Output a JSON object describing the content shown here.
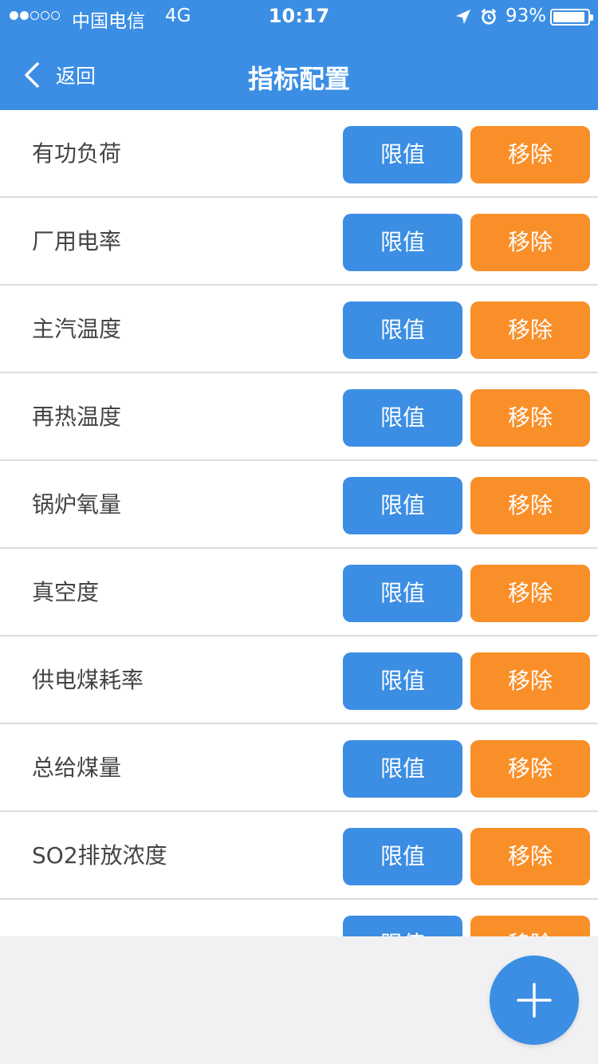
{
  "status_bar": {
    "carrier": "中国电信",
    "network": "4G",
    "time": "10:17",
    "battery_percent": "93%",
    "battery_level": 0.93,
    "signal_bars_filled": 2,
    "signal_bars_total": 5,
    "icons": [
      "location-icon",
      "alarm-icon",
      "battery-icon"
    ]
  },
  "nav": {
    "back_label": "返回",
    "title": "指标配置"
  },
  "items": [
    {
      "label": "有功负荷",
      "limit_label": "限值",
      "remove_label": "移除"
    },
    {
      "label": "厂用电率",
      "limit_label": "限值",
      "remove_label": "移除"
    },
    {
      "label": "主汽温度",
      "limit_label": "限值",
      "remove_label": "移除"
    },
    {
      "label": "再热温度",
      "limit_label": "限值",
      "remove_label": "移除"
    },
    {
      "label": "锅炉氧量",
      "limit_label": "限值",
      "remove_label": "移除"
    },
    {
      "label": "真空度",
      "limit_label": "限值",
      "remove_label": "移除"
    },
    {
      "label": "供电煤耗率",
      "limit_label": "限值",
      "remove_label": "移除"
    },
    {
      "label": "总给煤量",
      "limit_label": "限值",
      "remove_label": "移除"
    },
    {
      "label": "SO2排放浓度",
      "limit_label": "限值",
      "remove_label": "移除"
    },
    {
      "label": "",
      "limit_label": "限值",
      "remove_label": "移除"
    }
  ],
  "fab": {
    "icon": "plus-icon"
  },
  "colors": {
    "primary": "#3b8ee4",
    "remove": "#f98f28",
    "background": "#f1f1f3",
    "label_text": "#444444"
  }
}
